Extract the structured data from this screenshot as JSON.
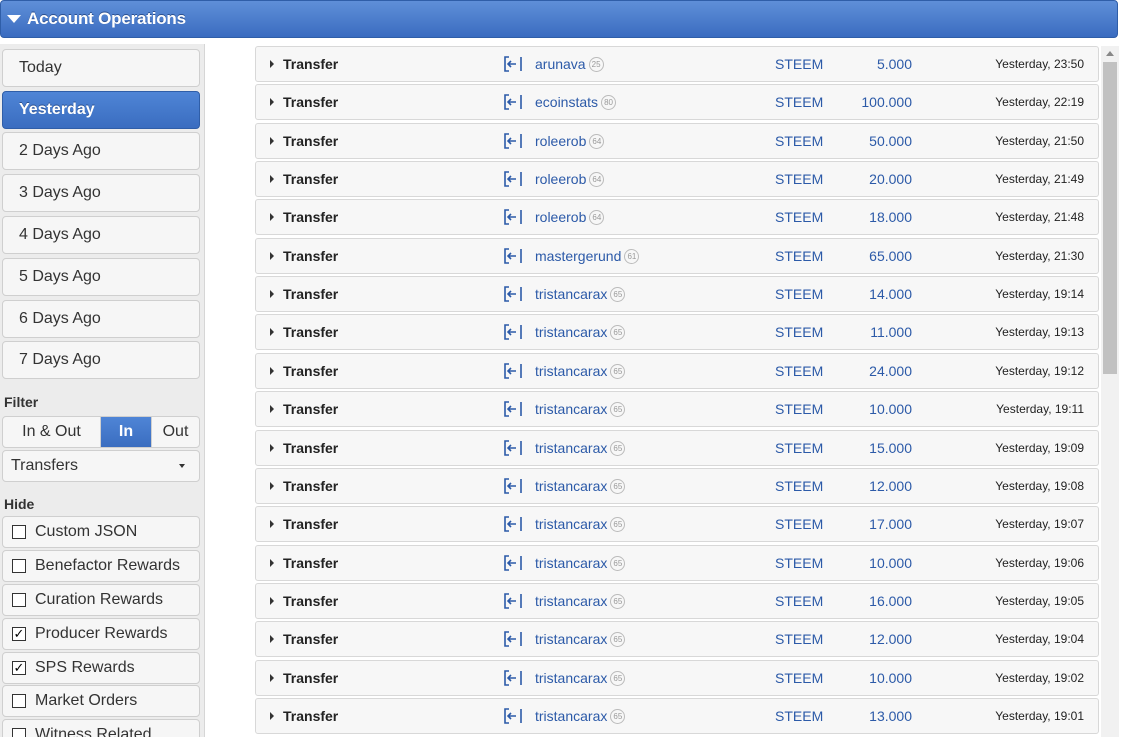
{
  "header": {
    "title": "Account Operations"
  },
  "sidebar": {
    "days": [
      "Today",
      "Yesterday",
      "2 Days Ago",
      "3 Days Ago",
      "4 Days Ago",
      "5 Days Ago",
      "6 Days Ago",
      "7 Days Ago"
    ],
    "active_day": "Yesterday",
    "filter_label": "Filter",
    "direction": {
      "options": [
        "In & Out",
        "In",
        "Out"
      ],
      "selected": "In"
    },
    "type_select": {
      "value": "Transfers"
    },
    "hide_label": "Hide",
    "hide_options": [
      {
        "label": "Custom JSON",
        "checked": false
      },
      {
        "label": "Benefactor Rewards",
        "checked": false
      },
      {
        "label": "Curation Rewards",
        "checked": false
      },
      {
        "label": "Producer Rewards",
        "checked": true
      },
      {
        "label": "SPS Rewards",
        "checked": true
      },
      {
        "label": "Market Orders",
        "checked": false
      },
      {
        "label": "Witness Related",
        "checked": false
      }
    ]
  },
  "operations": [
    {
      "type": "Transfer",
      "user": "arunava",
      "rep": "25",
      "currency": "STEEM",
      "amount": "5.000",
      "time": "Yesterday, 23:50"
    },
    {
      "type": "Transfer",
      "user": "ecoinstats",
      "rep": "80",
      "currency": "STEEM",
      "amount": "100.000",
      "time": "Yesterday, 22:19"
    },
    {
      "type": "Transfer",
      "user": "roleerob",
      "rep": "64",
      "currency": "STEEM",
      "amount": "50.000",
      "time": "Yesterday, 21:50"
    },
    {
      "type": "Transfer",
      "user": "roleerob",
      "rep": "64",
      "currency": "STEEM",
      "amount": "20.000",
      "time": "Yesterday, 21:49"
    },
    {
      "type": "Transfer",
      "user": "roleerob",
      "rep": "64",
      "currency": "STEEM",
      "amount": "18.000",
      "time": "Yesterday, 21:48"
    },
    {
      "type": "Transfer",
      "user": "mastergerund",
      "rep": "61",
      "currency": "STEEM",
      "amount": "65.000",
      "time": "Yesterday, 21:30"
    },
    {
      "type": "Transfer",
      "user": "tristancarax",
      "rep": "65",
      "currency": "STEEM",
      "amount": "14.000",
      "time": "Yesterday, 19:14"
    },
    {
      "type": "Transfer",
      "user": "tristancarax",
      "rep": "65",
      "currency": "STEEM",
      "amount": "11.000",
      "time": "Yesterday, 19:13"
    },
    {
      "type": "Transfer",
      "user": "tristancarax",
      "rep": "65",
      "currency": "STEEM",
      "amount": "24.000",
      "time": "Yesterday, 19:12"
    },
    {
      "type": "Transfer",
      "user": "tristancarax",
      "rep": "65",
      "currency": "STEEM",
      "amount": "10.000",
      "time": "Yesterday, 19:11"
    },
    {
      "type": "Transfer",
      "user": "tristancarax",
      "rep": "65",
      "currency": "STEEM",
      "amount": "15.000",
      "time": "Yesterday, 19:09"
    },
    {
      "type": "Transfer",
      "user": "tristancarax",
      "rep": "65",
      "currency": "STEEM",
      "amount": "12.000",
      "time": "Yesterday, 19:08"
    },
    {
      "type": "Transfer",
      "user": "tristancarax",
      "rep": "65",
      "currency": "STEEM",
      "amount": "17.000",
      "time": "Yesterday, 19:07"
    },
    {
      "type": "Transfer",
      "user": "tristancarax",
      "rep": "65",
      "currency": "STEEM",
      "amount": "10.000",
      "time": "Yesterday, 19:06"
    },
    {
      "type": "Transfer",
      "user": "tristancarax",
      "rep": "65",
      "currency": "STEEM",
      "amount": "16.000",
      "time": "Yesterday, 19:05"
    },
    {
      "type": "Transfer",
      "user": "tristancarax",
      "rep": "65",
      "currency": "STEEM",
      "amount": "12.000",
      "time": "Yesterday, 19:04"
    },
    {
      "type": "Transfer",
      "user": "tristancarax",
      "rep": "65",
      "currency": "STEEM",
      "amount": "10.000",
      "time": "Yesterday, 19:02"
    },
    {
      "type": "Transfer",
      "user": "tristancarax",
      "rep": "65",
      "currency": "STEEM",
      "amount": "13.000",
      "time": "Yesterday, 19:01"
    }
  ],
  "icons": {
    "direction_in": "incoming-transfer-icon",
    "expand": "expand-arrow-icon"
  },
  "colors": {
    "accent": "#3a6dc0",
    "link": "#2c5aa8"
  }
}
